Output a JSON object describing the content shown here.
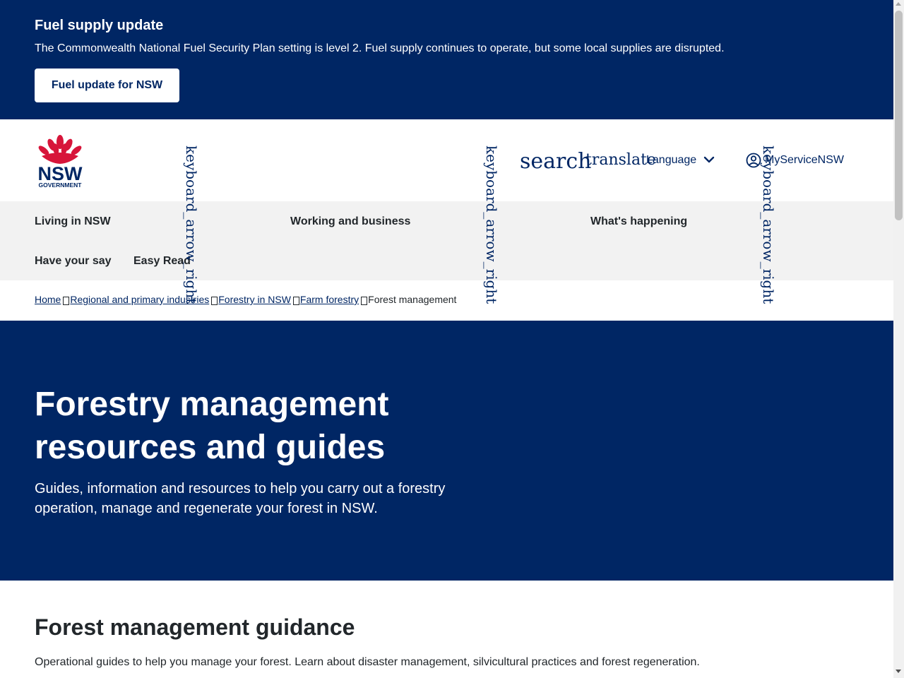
{
  "alert": {
    "title": "Fuel supply update",
    "text": "The Commonwealth National Fuel Security Plan setting is level 2. Fuel supply continues to operate, but some local supplies are disrupted.",
    "button_label": "Fuel update for NSW"
  },
  "header": {
    "logo_text": "NSW",
    "logo_subtext": "GOVERNMENT",
    "search_icon_text": "search",
    "translate_icon_text": "translate",
    "language_label": "Language",
    "account_label": "MyServiceNSW"
  },
  "nav": {
    "items": [
      {
        "label": "Living in NSW"
      },
      {
        "label": "Working and business"
      },
      {
        "label": "What's happening"
      },
      {
        "label": "Have your say"
      },
      {
        "label": "Easy Read"
      }
    ],
    "arrow_icon_text": "keyboard_arrow_right"
  },
  "breadcrumb": {
    "items": [
      {
        "label": "Home"
      },
      {
        "label": "Regional and primary industries"
      },
      {
        "label": "Forestry in NSW"
      },
      {
        "label": "Farm forestry"
      }
    ],
    "current": "Forest management"
  },
  "hero": {
    "title": "Forestry management resources and guides",
    "intro": "Guides, information and resources to help you carry out a forestry operation, manage and regenerate your forest in NSW."
  },
  "section": {
    "title": "Forest management guidance",
    "text": "Operational guides to help you manage your forest. Learn about disaster management, silvicultural practices and forest regeneration."
  },
  "colors": {
    "brand_navy": "#002664",
    "waratah_red": "#d7153a",
    "nav_background": "#f2f2f2"
  }
}
